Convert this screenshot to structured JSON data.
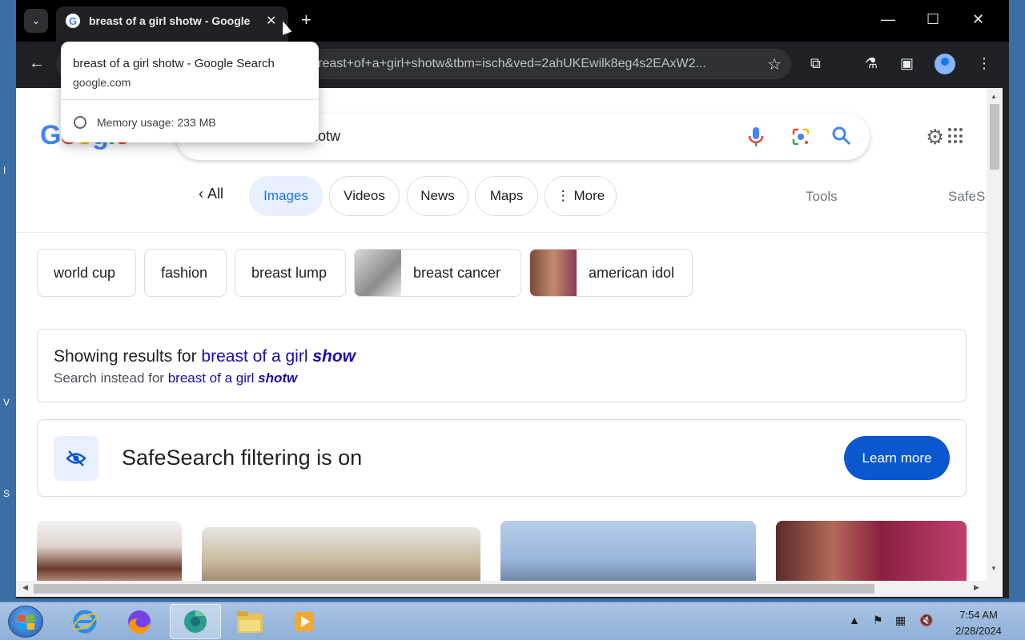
{
  "browser": {
    "tab_title": "breast of a girl shotw - Google Search",
    "tab_title_visible": "breast of a girl shotw - Google",
    "close_tab": "✕",
    "new_tab": "+",
    "minimize": "—",
    "maximize": "☐",
    "close_window": "✕",
    "url_visible": "q=breast+of+a+girl+shotw&tbm=isch&ved=2ahUKEwilk8eg4s2EAxW2...",
    "tooltip": {
      "title": "breast of a girl shotw - Google Search",
      "domain": "google.com",
      "memory": "Memory usage: 233 MB"
    }
  },
  "search": {
    "query_visible": "shotw",
    "nav": {
      "back_label": "All",
      "tabs": [
        "Images",
        "Videos",
        "News",
        "Maps",
        "More"
      ],
      "tools": "Tools",
      "safesearch": "SafeS"
    },
    "refinements": [
      "world cup",
      "fashion",
      "breast lump",
      "breast cancer",
      "american idol"
    ],
    "correction": {
      "showing_prefix": "Showing results for ",
      "showing_plain": "breast of a girl ",
      "showing_bold": "show",
      "instead_prefix": "Search instead for ",
      "instead_plain": "breast of a girl ",
      "instead_bold": "shotw"
    },
    "safesearch_card": {
      "title": "SafeSearch filtering is on",
      "button": "Learn more"
    }
  },
  "taskbar": {
    "time": "7:54 AM",
    "date": "2/28/2024"
  },
  "colors": {
    "accent": "#1a73e8",
    "link": "#1a0dab",
    "button": "#0b57d0"
  }
}
